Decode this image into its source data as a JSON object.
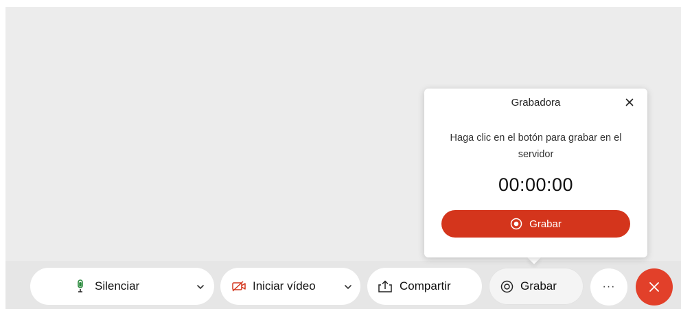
{
  "popup": {
    "title": "Grabadora",
    "description": "Haga clic en el botón para grabar en el servidor",
    "timer": "00:00:00",
    "record_label": "Grabar"
  },
  "toolbar": {
    "mute_label": "Silenciar",
    "video_label": "Iniciar vídeo",
    "share_label": "Compartir",
    "record_label": "Grabar",
    "more_label": "···"
  },
  "colors": {
    "accent_red": "#d4351c",
    "end_red": "#e2402a",
    "mic_green": "#2b8a3e",
    "background": "#ececec"
  },
  "icons": {
    "mute": "microphone-icon",
    "video": "video-off-icon",
    "share": "share-icon",
    "record": "record-icon",
    "end": "close-icon"
  }
}
